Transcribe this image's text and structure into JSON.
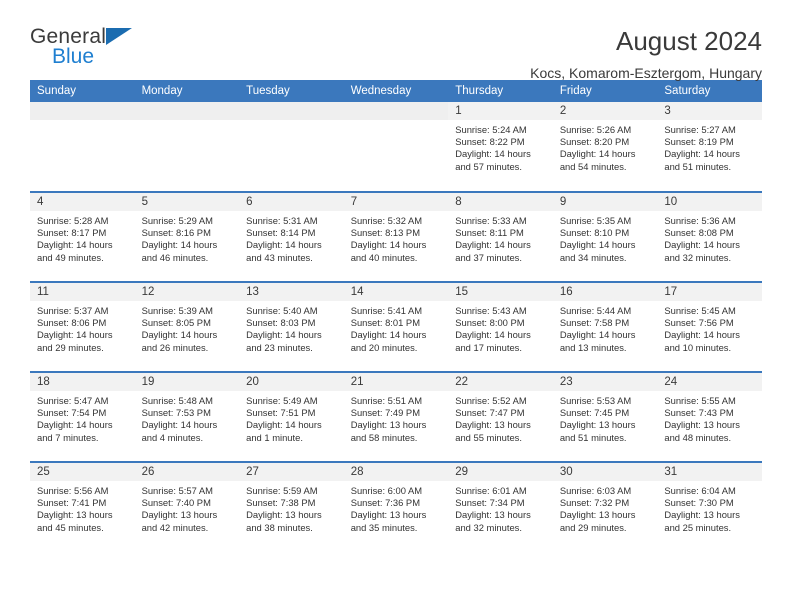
{
  "brand": {
    "name_top": "General",
    "name_bottom": "Blue",
    "accent_color": "#1f7fd0",
    "triangle_color": "#1b6cb0"
  },
  "header": {
    "title": "August 2024",
    "subtitle": "Kocs, Komarom-Esztergom, Hungary",
    "header_bg": "#3b78bd",
    "row_divider_color": "#3b78bd",
    "daynum_bg": "#f2f2f2"
  },
  "weekdays": [
    "Sunday",
    "Monday",
    "Tuesday",
    "Wednesday",
    "Thursday",
    "Friday",
    "Saturday"
  ],
  "labels": {
    "sunrise_prefix": "Sunrise:",
    "sunset_prefix": "Sunset:",
    "daylight_prefix": "Daylight:"
  },
  "weeks": [
    [
      {
        "day": "",
        "empty": true
      },
      {
        "day": "",
        "empty": true
      },
      {
        "day": "",
        "empty": true
      },
      {
        "day": "",
        "empty": true
      },
      {
        "day": "1",
        "sunrise": "Sunrise: 5:24 AM",
        "sunset": "Sunset: 8:22 PM",
        "daylight": "Daylight: 14 hours and 57 minutes."
      },
      {
        "day": "2",
        "sunrise": "Sunrise: 5:26 AM",
        "sunset": "Sunset: 8:20 PM",
        "daylight": "Daylight: 14 hours and 54 minutes."
      },
      {
        "day": "3",
        "sunrise": "Sunrise: 5:27 AM",
        "sunset": "Sunset: 8:19 PM",
        "daylight": "Daylight: 14 hours and 51 minutes."
      }
    ],
    [
      {
        "day": "4",
        "sunrise": "Sunrise: 5:28 AM",
        "sunset": "Sunset: 8:17 PM",
        "daylight": "Daylight: 14 hours and 49 minutes."
      },
      {
        "day": "5",
        "sunrise": "Sunrise: 5:29 AM",
        "sunset": "Sunset: 8:16 PM",
        "daylight": "Daylight: 14 hours and 46 minutes."
      },
      {
        "day": "6",
        "sunrise": "Sunrise: 5:31 AM",
        "sunset": "Sunset: 8:14 PM",
        "daylight": "Daylight: 14 hours and 43 minutes."
      },
      {
        "day": "7",
        "sunrise": "Sunrise: 5:32 AM",
        "sunset": "Sunset: 8:13 PM",
        "daylight": "Daylight: 14 hours and 40 minutes."
      },
      {
        "day": "8",
        "sunrise": "Sunrise: 5:33 AM",
        "sunset": "Sunset: 8:11 PM",
        "daylight": "Daylight: 14 hours and 37 minutes."
      },
      {
        "day": "9",
        "sunrise": "Sunrise: 5:35 AM",
        "sunset": "Sunset: 8:10 PM",
        "daylight": "Daylight: 14 hours and 34 minutes."
      },
      {
        "day": "10",
        "sunrise": "Sunrise: 5:36 AM",
        "sunset": "Sunset: 8:08 PM",
        "daylight": "Daylight: 14 hours and 32 minutes."
      }
    ],
    [
      {
        "day": "11",
        "sunrise": "Sunrise: 5:37 AM",
        "sunset": "Sunset: 8:06 PM",
        "daylight": "Daylight: 14 hours and 29 minutes."
      },
      {
        "day": "12",
        "sunrise": "Sunrise: 5:39 AM",
        "sunset": "Sunset: 8:05 PM",
        "daylight": "Daylight: 14 hours and 26 minutes."
      },
      {
        "day": "13",
        "sunrise": "Sunrise: 5:40 AM",
        "sunset": "Sunset: 8:03 PM",
        "daylight": "Daylight: 14 hours and 23 minutes."
      },
      {
        "day": "14",
        "sunrise": "Sunrise: 5:41 AM",
        "sunset": "Sunset: 8:01 PM",
        "daylight": "Daylight: 14 hours and 20 minutes."
      },
      {
        "day": "15",
        "sunrise": "Sunrise: 5:43 AM",
        "sunset": "Sunset: 8:00 PM",
        "daylight": "Daylight: 14 hours and 17 minutes."
      },
      {
        "day": "16",
        "sunrise": "Sunrise: 5:44 AM",
        "sunset": "Sunset: 7:58 PM",
        "daylight": "Daylight: 14 hours and 13 minutes."
      },
      {
        "day": "17",
        "sunrise": "Sunrise: 5:45 AM",
        "sunset": "Sunset: 7:56 PM",
        "daylight": "Daylight: 14 hours and 10 minutes."
      }
    ],
    [
      {
        "day": "18",
        "sunrise": "Sunrise: 5:47 AM",
        "sunset": "Sunset: 7:54 PM",
        "daylight": "Daylight: 14 hours and 7 minutes."
      },
      {
        "day": "19",
        "sunrise": "Sunrise: 5:48 AM",
        "sunset": "Sunset: 7:53 PM",
        "daylight": "Daylight: 14 hours and 4 minutes."
      },
      {
        "day": "20",
        "sunrise": "Sunrise: 5:49 AM",
        "sunset": "Sunset: 7:51 PM",
        "daylight": "Daylight: 14 hours and 1 minute."
      },
      {
        "day": "21",
        "sunrise": "Sunrise: 5:51 AM",
        "sunset": "Sunset: 7:49 PM",
        "daylight": "Daylight: 13 hours and 58 minutes."
      },
      {
        "day": "22",
        "sunrise": "Sunrise: 5:52 AM",
        "sunset": "Sunset: 7:47 PM",
        "daylight": "Daylight: 13 hours and 55 minutes."
      },
      {
        "day": "23",
        "sunrise": "Sunrise: 5:53 AM",
        "sunset": "Sunset: 7:45 PM",
        "daylight": "Daylight: 13 hours and 51 minutes."
      },
      {
        "day": "24",
        "sunrise": "Sunrise: 5:55 AM",
        "sunset": "Sunset: 7:43 PM",
        "daylight": "Daylight: 13 hours and 48 minutes."
      }
    ],
    [
      {
        "day": "25",
        "sunrise": "Sunrise: 5:56 AM",
        "sunset": "Sunset: 7:41 PM",
        "daylight": "Daylight: 13 hours and 45 minutes."
      },
      {
        "day": "26",
        "sunrise": "Sunrise: 5:57 AM",
        "sunset": "Sunset: 7:40 PM",
        "daylight": "Daylight: 13 hours and 42 minutes."
      },
      {
        "day": "27",
        "sunrise": "Sunrise: 5:59 AM",
        "sunset": "Sunset: 7:38 PM",
        "daylight": "Daylight: 13 hours and 38 minutes."
      },
      {
        "day": "28",
        "sunrise": "Sunrise: 6:00 AM",
        "sunset": "Sunset: 7:36 PM",
        "daylight": "Daylight: 13 hours and 35 minutes."
      },
      {
        "day": "29",
        "sunrise": "Sunrise: 6:01 AM",
        "sunset": "Sunset: 7:34 PM",
        "daylight": "Daylight: 13 hours and 32 minutes."
      },
      {
        "day": "30",
        "sunrise": "Sunrise: 6:03 AM",
        "sunset": "Sunset: 7:32 PM",
        "daylight": "Daylight: 13 hours and 29 minutes."
      },
      {
        "day": "31",
        "sunrise": "Sunrise: 6:04 AM",
        "sunset": "Sunset: 7:30 PM",
        "daylight": "Daylight: 13 hours and 25 minutes."
      }
    ]
  ]
}
